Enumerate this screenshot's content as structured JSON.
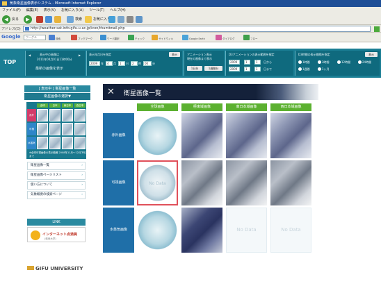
{
  "window": {
    "title": "気象衛星画像表示システム - Microsoft Internet Explorer"
  },
  "menu": [
    "ファイル(F)",
    "編集(E)",
    "表示(V)",
    "お気に入り(A)",
    "ツール(T)",
    "ヘルプ(H)"
  ],
  "toolbar": {
    "back": "戻る",
    "search": "検索",
    "favorites": "お気に入り"
  },
  "address": {
    "label": "アドレス(D)",
    "url": "http://weather-sat.info.gifu-u.ac.jp/icon/thumbnail.php"
  },
  "googlebar": {
    "logo": "Google",
    "search_placeholder": "ウーグル",
    "search_btn": "検索",
    "labels": [
      "ブックマーク",
      "ワード翻訳",
      "チェック",
      "サイドウィキ",
      "Google Earth",
      "ダイアログ",
      "フロー"
    ]
  },
  "header": {
    "top_label": "TOP",
    "current_label": "表示中の画像は",
    "current_value": "2011年04月01日11時00分",
    "show_latest": "最新の画像を表示",
    "date_label": "表示年月日を指定",
    "date_year": "2009",
    "date_month": "4",
    "date_day": "1",
    "date_hour": "2",
    "date_min": "00",
    "unit_year": "年",
    "unit_month": "月",
    "unit_day": "日",
    "unit_hour": "時",
    "unit_min": "分",
    "date_btn": "表示",
    "anim_label": "アニメーション表示",
    "anim_sub": "現在の画像まで表示",
    "anim_1h": "1日分",
    "anim_1w": "1週間分",
    "range_label": "D3アニメーションの表示範囲を指定",
    "range_from_y": "2009",
    "range_from_m": "1",
    "range_from_d": "1",
    "range_to_y": "2009",
    "range_to_m": "1",
    "range_to_d": "1",
    "range_from_txt": "日から",
    "range_to_txt": "日まで",
    "interval_label": "D3時間の表示間隔を指定",
    "intervals_row1": [
      "1時間",
      "3時間",
      "12時間",
      "24時間"
    ],
    "intervals_row2": [
      "1週間",
      "1ヶ月"
    ],
    "interval_btn": "表示"
  },
  "sidebar": {
    "current_header": "[ 表示中 ] 衛星画像一覧",
    "select_header": "衛星画像の選択▼",
    "grid_cols": [
      "全球",
      "日本",
      "東日本",
      "西日本"
    ],
    "grid_rows": [
      "赤外",
      "可視",
      "水蒸気"
    ],
    "note": "※全球可視画像の表示範囲 2008年11月〜12月下旬まで",
    "links": [
      "衛星画像一覧",
      "衛星画像ページリスト",
      "使い方について",
      "気象概要の検索ページ"
    ],
    "link_header": "LINK",
    "inet_title": "インターネット点滴員",
    "inet_sub": "(岐阜大学)",
    "footer_logo": "GIFU UNIVERSITY"
  },
  "main": {
    "title": "衛星画像一覧",
    "sat_icon": "satellite-icon",
    "columns": [
      "全球画像",
      "極東域画像",
      "東日本域画像",
      "西日本域画像"
    ],
    "rows": [
      "赤外画像",
      "可視画像",
      "水蒸気画像"
    ],
    "no_data": "No Data"
  },
  "colors": {
    "header": "#1a7e94",
    "green": "#5cb130",
    "row_blue": "#1f6fa8",
    "selected": "#e0505a",
    "dark_title": "#14213a"
  }
}
